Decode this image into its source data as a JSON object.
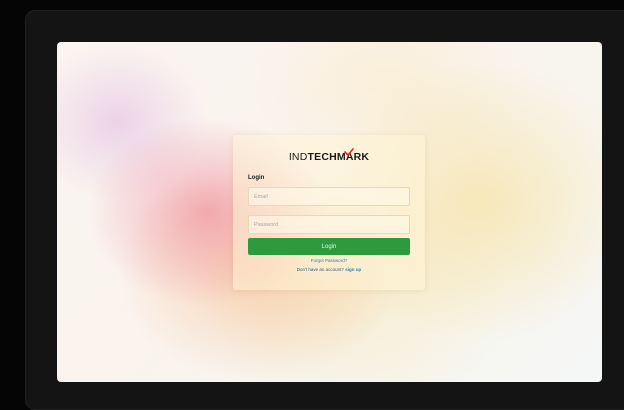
{
  "brand": {
    "logo_light": "IND",
    "logo_bold": "TECHMARK",
    "accent_color": "#d92b2b"
  },
  "login": {
    "heading": "Login",
    "email_placeholder": "Email",
    "password_placeholder": "Password",
    "button_label": "Login",
    "button_color": "#2d9a3e",
    "forgot_password": "Forgot Password?",
    "no_account_text": "Don't have an account?",
    "signup_link": "sign up"
  }
}
